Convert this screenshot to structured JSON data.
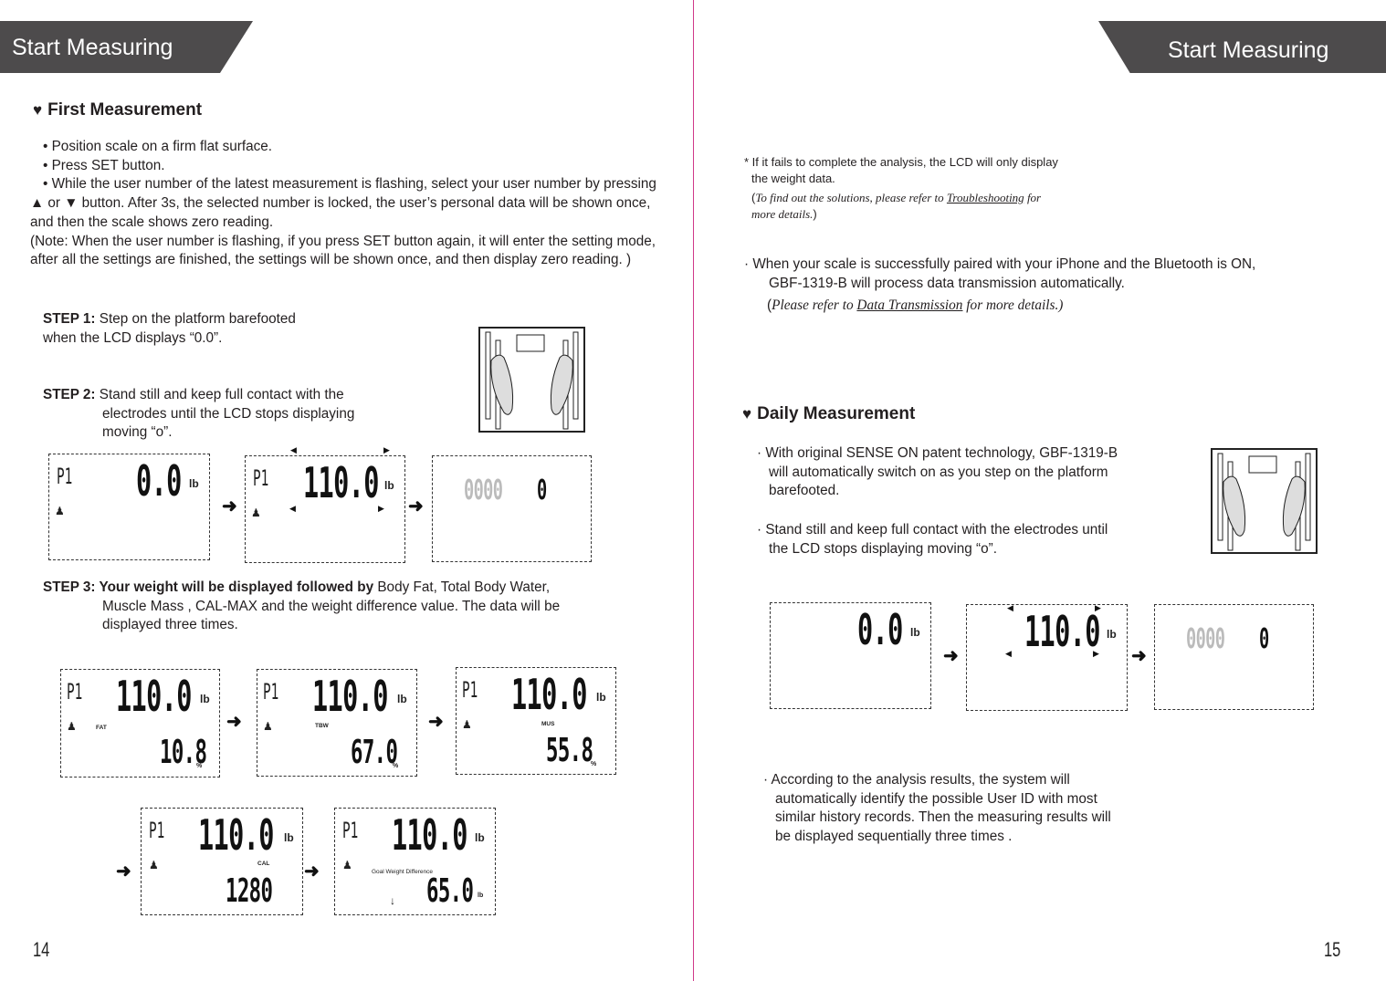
{
  "left_page": {
    "banner": "Start Measuring",
    "section_title": "First Measurement",
    "bullets": [
      "• Position scale on a firm flat surface.",
      "• Press SET button.",
      "• While the user number of the latest measurement is flashing, select your user number by pressing ▲ or  ▼  button. After 3s, the selected number is locked, the user’s personal data will be shown once,  and then the scale shows zero reading.",
      "(Note: When the user number is flashing, if you press SET button again, it will enter the setting mode, after all the settings are finished, the settings will be shown once, and then display zero reading. )"
    ],
    "step1": {
      "label": "STEP 1:",
      "text": " Step on the platform barefooted",
      "text2": "when the LCD displays “0.0”."
    },
    "step2": {
      "label": "STEP 2:",
      "text": " Stand still and keep full contact with the",
      "text2": "electrodes until the LCD stops displaying",
      "text3": "moving “o”."
    },
    "step3": {
      "label": "STEP 3:",
      "bold": " Your weight will be displayed followed by",
      "text": " Body Fat, Total Body Water,",
      "text2": "Muscle Mass , CAL-MAX  and the weight difference value. The data will be",
      "text3": "displayed  three times."
    },
    "lcd_row1": [
      {
        "user": "P1",
        "value": "0.0",
        "unit": "lb"
      },
      {
        "user": "P1",
        "value": "110.0",
        "unit": "lb"
      },
      {
        "ghost": "0000",
        "value": "0"
      }
    ],
    "lcd_row2": [
      {
        "user": "P1",
        "value": "110.0",
        "unit": "lb",
        "label": "FAT",
        "sub": "10.8",
        "sub_unit": "%"
      },
      {
        "user": "P1",
        "value": "110.0",
        "unit": "lb",
        "label": "TBW",
        "sub": "67.0",
        "sub_unit": "%"
      },
      {
        "user": "P1",
        "value": "110.0",
        "unit": "lb",
        "label": "MUS",
        "sub": "55.8",
        "sub_unit": "%"
      }
    ],
    "lcd_row3": [
      {
        "user": "P1",
        "value": "110.0",
        "unit": "lb",
        "label": "CAL",
        "sub": "1280"
      },
      {
        "user": "P1",
        "value": "110.0",
        "unit": "lb",
        "label": "Goal Weight Difference",
        "sub": "65.0",
        "sub_unit": "lb",
        "direction": "↓"
      }
    ],
    "page_number": "14"
  },
  "right_page": {
    "banner": "Start Measuring",
    "note": {
      "line1": "* If it fails to complete the analysis, the LCD will only display",
      "line2": "the weight data.",
      "ref_pre": "To find out the solutions, please refer to ",
      "ref_link": "Troubleshooting",
      "ref_post": " for",
      "ref_line2": "more details."
    },
    "bluetooth": {
      "line1": "·  When your scale is successfully paired with your iPhone and the Bluetooth is ON,",
      "line2": "GBF-1319-B will process data transmission automatically.",
      "ref_pre": "Please refer to ",
      "ref_link": "Data Transmission",
      "ref_post": " for more details.)"
    },
    "section_title": "Daily Measurement",
    "daily_bullets": [
      {
        "line1": "· With original SENSE ON patent technology, GBF-1319-B",
        "line2": "will automatically switch on as you step on the platform",
        "line3": "barefooted."
      },
      {
        "line1": "· Stand still and keep full contact with the electrodes until",
        "line2": "the LCD stops displaying moving “o”."
      }
    ],
    "lcd_row": [
      {
        "value": "0.0",
        "unit": "lb"
      },
      {
        "value": "110.0",
        "unit": "lb"
      },
      {
        "ghost": "0000",
        "value": "0"
      }
    ],
    "final_bullet": {
      "line1": "· According to the analysis results, the system will",
      "line2": "automatically identify the possible User ID with most",
      "line3": "similar history records. Then the measuring results will",
      "line4": "be displayed sequentially three times ."
    },
    "page_number": "15"
  },
  "colors": {
    "banner": "#4d4b4c",
    "divider": "#d0398a",
    "text": "#231f20"
  }
}
